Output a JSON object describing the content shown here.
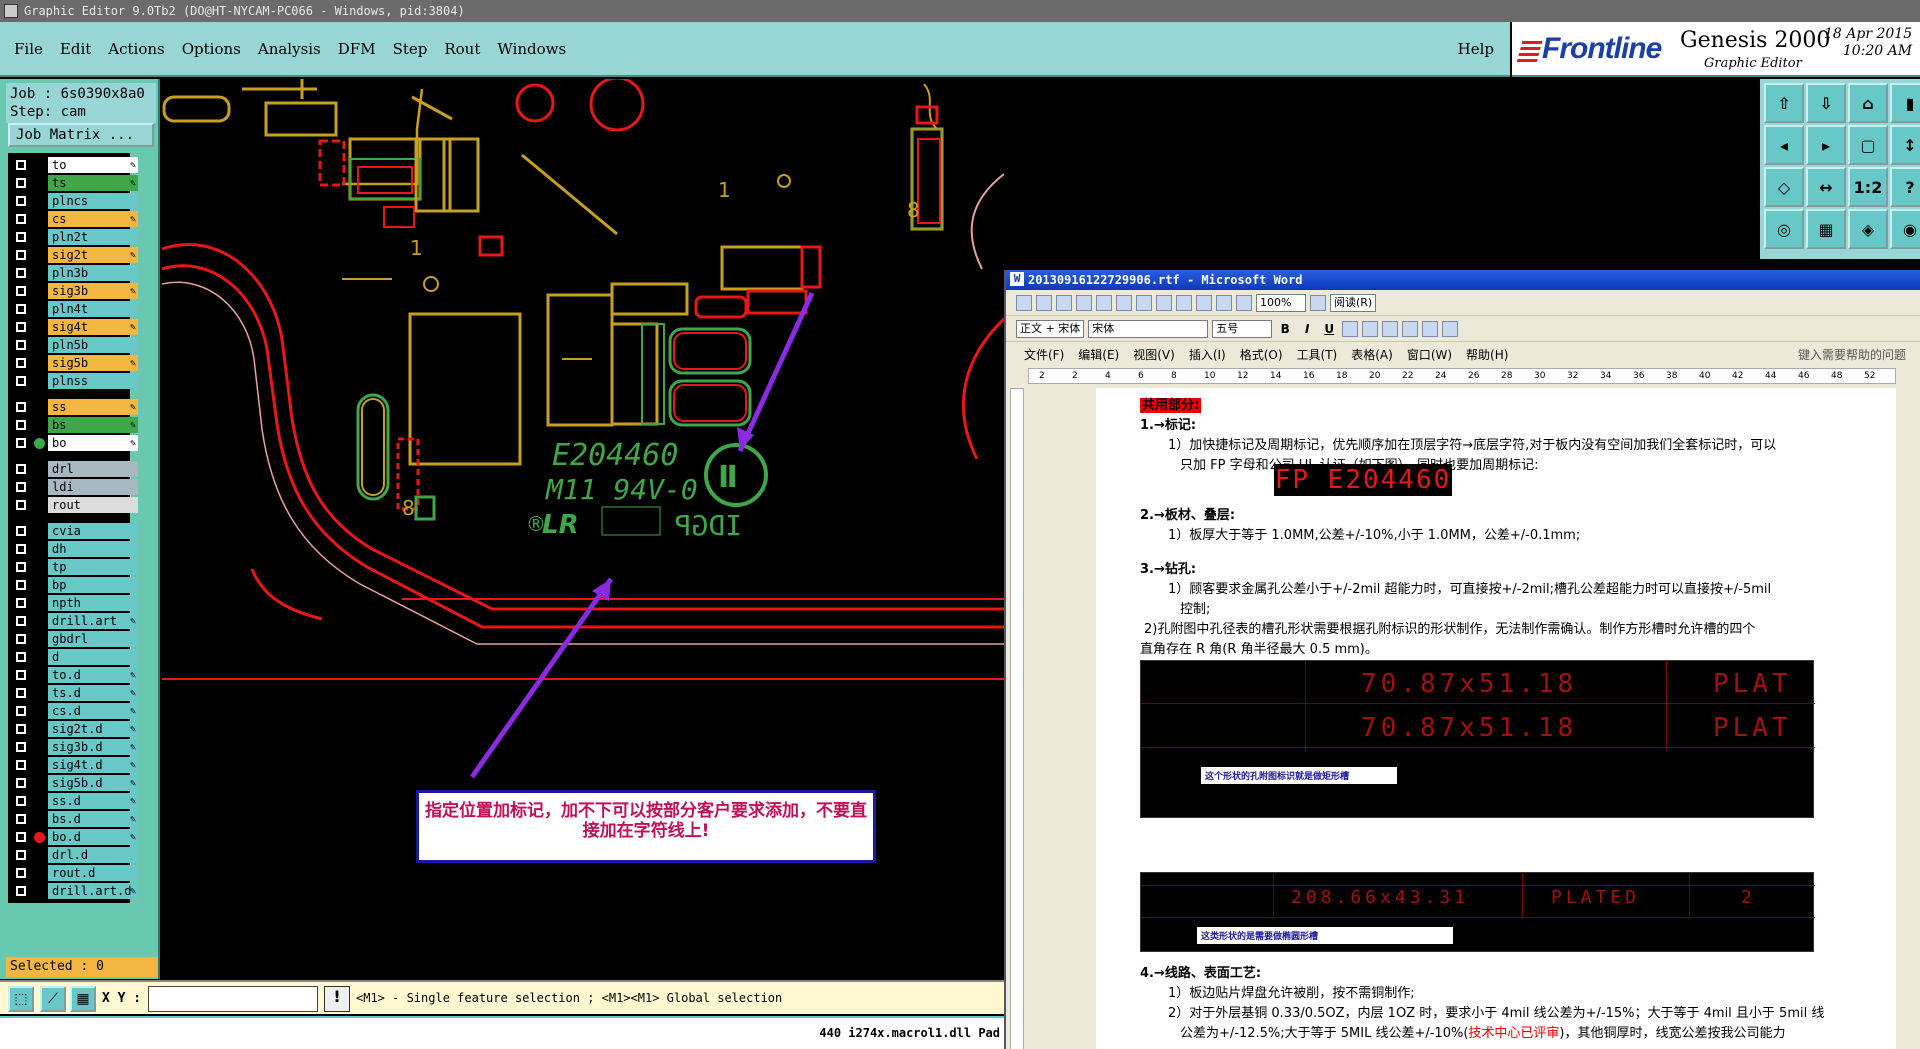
{
  "window": {
    "title": "Graphic Editor 9.0Tb2 (DO@HT-NYCAM-PC066 - Windows, pid:3804)"
  },
  "menu": {
    "items": [
      "File",
      "Edit",
      "Actions",
      "Options",
      "Analysis",
      "DFM",
      "Step",
      "Rout",
      "Windows"
    ],
    "help": "Help"
  },
  "brand": {
    "logo": "Frontline",
    "product": "Genesis 2000",
    "subtitle": "Graphic Editor",
    "date": "18 Apr 2015",
    "time": "10:20 AM"
  },
  "job": {
    "job_line": "Job : 6s0390x8a0",
    "step_line": "Step: cam",
    "matrix_button": "Job Matrix ..."
  },
  "layers": [
    {
      "name": "to",
      "color": "#ffffff",
      "pen": true
    },
    {
      "name": "ts",
      "color": "#3fa64a",
      "pen": true
    },
    {
      "name": "plncs",
      "color": "#68c8c8"
    },
    {
      "name": "cs",
      "color": "#f3b640",
      "pen": true
    },
    {
      "name": "pln2t",
      "color": "#68c8c8"
    },
    {
      "name": "sig2t",
      "color": "#f3b640",
      "pen": true
    },
    {
      "name": "pln3b",
      "color": "#68c8c8"
    },
    {
      "name": "sig3b",
      "color": "#f3b640",
      "pen": true
    },
    {
      "name": "pln4t",
      "color": "#68c8c8"
    },
    {
      "name": "sig4t",
      "color": "#f3b640",
      "pen": true
    },
    {
      "name": "pln5b",
      "color": "#68c8c8"
    },
    {
      "name": "sig5b",
      "color": "#f3b640",
      "pen": true
    },
    {
      "name": "plnss",
      "color": "#68c8c8"
    },
    {
      "name": "ss",
      "color": "#f3b640",
      "pen": true,
      "gap_before": true
    },
    {
      "name": "bs",
      "color": "#3fa64a",
      "pen": true
    },
    {
      "name": "bo",
      "color": "#ffffff",
      "pen": true,
      "dot": "#3fa64a"
    },
    {
      "name": "drl",
      "color": "#a8b8c0",
      "gap_before": true
    },
    {
      "name": "ldi",
      "color": "#a8b8c0"
    },
    {
      "name": "rout",
      "color": "#dcdcdc"
    },
    {
      "name": "cvia",
      "color": "#68c8c8",
      "gap_before": true
    },
    {
      "name": "dh",
      "color": "#68c8c8"
    },
    {
      "name": "tp",
      "color": "#68c8c8"
    },
    {
      "name": "bp",
      "color": "#68c8c8"
    },
    {
      "name": "npth",
      "color": "#68c8c8"
    },
    {
      "name": "drill.art",
      "color": "#68c8c8",
      "pen": true
    },
    {
      "name": "gbdrl",
      "color": "#68c8c8"
    },
    {
      "name": "d",
      "color": "#68c8c8"
    },
    {
      "name": "to.d",
      "color": "#68c8c8",
      "pen": true
    },
    {
      "name": "ts.d",
      "color": "#68c8c8",
      "pen": true
    },
    {
      "name": "cs.d",
      "color": "#68c8c8",
      "pen": true
    },
    {
      "name": "sig2t.d",
      "color": "#68c8c8",
      "pen": true
    },
    {
      "name": "sig3b.d",
      "color": "#68c8c8",
      "pen": true
    },
    {
      "name": "sig4t.d",
      "color": "#68c8c8",
      "pen": true
    },
    {
      "name": "sig5b.d",
      "color": "#68c8c8",
      "pen": true
    },
    {
      "name": "ss.d",
      "color": "#68c8c8",
      "pen": true
    },
    {
      "name": "bs.d",
      "color": "#68c8c8",
      "pen": true
    },
    {
      "name": "bo.d",
      "color": "#68c8c8",
      "pen": true,
      "dot": "#e81818"
    },
    {
      "name": "drl.d",
      "color": "#68c8c8"
    },
    {
      "name": "rout.d",
      "color": "#68c8c8"
    },
    {
      "name": "drill.art.d",
      "color": "#68c8c8",
      "pen": true
    }
  ],
  "selected": "Selected : 0",
  "canvas": {
    "callout": "指定位置加标记，加不下可以按部分客户要求添加，不要直接加在字符线上!",
    "silk": {
      "line1": "E204460",
      "line2": "M11 94V-0",
      "line3": "LR",
      "rev1": "IDGP",
      "digit1": "1",
      "digit2": "8",
      "digit3": "8"
    }
  },
  "bottom": {
    "xy_label": "X Y :",
    "xy_value": "",
    "hint": "<M1> - Single feature selection ; <M1><M1> Global selection",
    "warn": "!"
  },
  "status": "440 i274x.macrol1.dll Pad",
  "right_tools": [
    "⇧",
    "⇩",
    "⌂",
    "▮",
    "◂",
    "▸",
    "▢",
    "↕",
    "◇",
    "↔",
    "1:2",
    "?",
    "◎",
    "▦",
    "◈",
    "◉"
  ],
  "word": {
    "title": "20130916122729906.rtf - Microsoft Word",
    "zoom": "100%",
    "read_btn": "阅读(R)",
    "style": "正文 + 宋体",
    "font": "宋体",
    "size": "五号",
    "menu": [
      "文件(F)",
      "编辑(E)",
      "视图(V)",
      "插入(I)",
      "格式(O)",
      "工具(T)",
      "表格(A)",
      "窗口(W)",
      "帮助(H)"
    ],
    "ask": "键入需要帮助的问题",
    "ruler": [
      "2",
      "2",
      "4",
      "6",
      "8",
      "10",
      "12",
      "14",
      "16",
      "18",
      "20",
      "22",
      "24",
      "26",
      "28",
      "30",
      "32",
      "34",
      "36",
      "38",
      "40",
      "42",
      "44",
      "46",
      "48",
      "52"
    ],
    "doc": {
      "heading": "共用部分:",
      "s1": "1.→标记:",
      "s1a": "1）加快捷标记及周期标记，优先顺序加在顶层字符→底层字符,对于板内没有空间加我们全套标记时，可以",
      "s1b": "只加 FP 字母和公司 UL 认证（如下图），同时也要加周期标记:",
      "fp": "FP E204460",
      "s2": "2.→板材、叠层:",
      "s2a": "1）板厚大于等于 1.0MM,公差+/-10%,小于 1.0MM，公差+/-0.1mm;",
      "s3": "3.→钻孔:",
      "s3a": "1）顾客要求金属孔公差小于+/-2mil 超能力时，可直接按+/-2mil;槽孔公差超能力时可以直接按+/-5mil",
      "s3b": "控制;",
      "s3c": "2)孔附图中孔径表的槽孔形状需要根据孔附标识的形状制作，无法制作需确认。制作方形槽时允许槽的四个",
      "s3d": "直角存在 R 角(R 角半径最大 0.5 mm)。",
      "img1": {
        "row1": "70.87x51.18",
        "row2": "70.87x51.18",
        "plat": "PLAT",
        "note": "这个形状的孔附图标识就是做矩形槽"
      },
      "img2": {
        "size": "208.66x43.31",
        "plated": "PLATED",
        "qty": "2",
        "note": "这类形状的是需要做椭圆形槽"
      },
      "s4": "4.→线路、表面工艺:",
      "s4a": "1）板边贴片焊盘允许被削，按不需铜制作;",
      "s4b": "2）对于外层基铜 0.33/0.5OZ，内层 1OZ 时，要求小于 4mil 线公差为+/-15%；大于等于 4mil 且小于 5mil 线",
      "s4c1": "公差为+/-12.5%;大于等于 5MIL 线公差+/-10%(",
      "s4c2": "技术中心已评审",
      "s4c3": ")，其他铜厚时，线宽公差按我公司能力"
    }
  }
}
